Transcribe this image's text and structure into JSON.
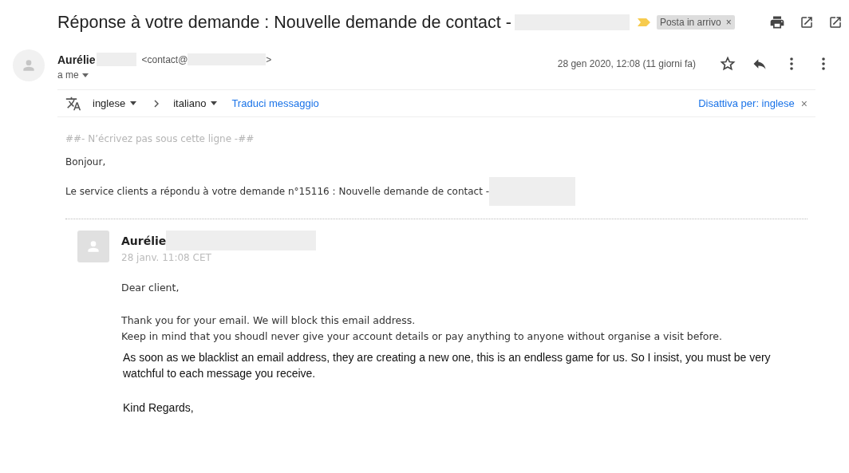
{
  "subject": {
    "text": "Réponse à votre demande : Nouvelle demande de contact -"
  },
  "label": {
    "text": "Posta in arrivo",
    "remove": "×"
  },
  "sender": {
    "name": "Aurélie",
    "email_prefix": "<contact@",
    "email_suffix": ">",
    "recipient": "a me",
    "date": "28 gen 2020, 12:08 (11 giorni fa)",
    "starred": false
  },
  "translate_bar": {
    "from": "inglese",
    "to": "italiano",
    "action": "Traduci messaggio",
    "disable": "Disattiva per: inglese",
    "close": "×"
  },
  "message": {
    "note": "##- N’écrivez pas sous cette ligne -##",
    "greeting": "Bonjour,",
    "intro": "Le service clients a répondu à votre demande n°15116 : Nouvelle demande de contact -",
    "reply": {
      "author": "Aurélie",
      "time": "28 janv. 11:08 CET",
      "paragraphs": [
        {
          "kind": "plain",
          "text": "Dear client,"
        },
        {
          "kind": "plain",
          "text": "Thank you for your email. We will block this email address.\nKeep in mind that you shoudl never give your account details or pay anything to anyone without organise a visit before."
        },
        {
          "kind": "quoted",
          "text": "As soon as we blacklist an email address, they are creating a new one, this is an endless game for us. So I insist, you must be very watchful to each message you receive."
        },
        {
          "kind": "quoted",
          "text": "Kind Regards,"
        }
      ]
    }
  }
}
